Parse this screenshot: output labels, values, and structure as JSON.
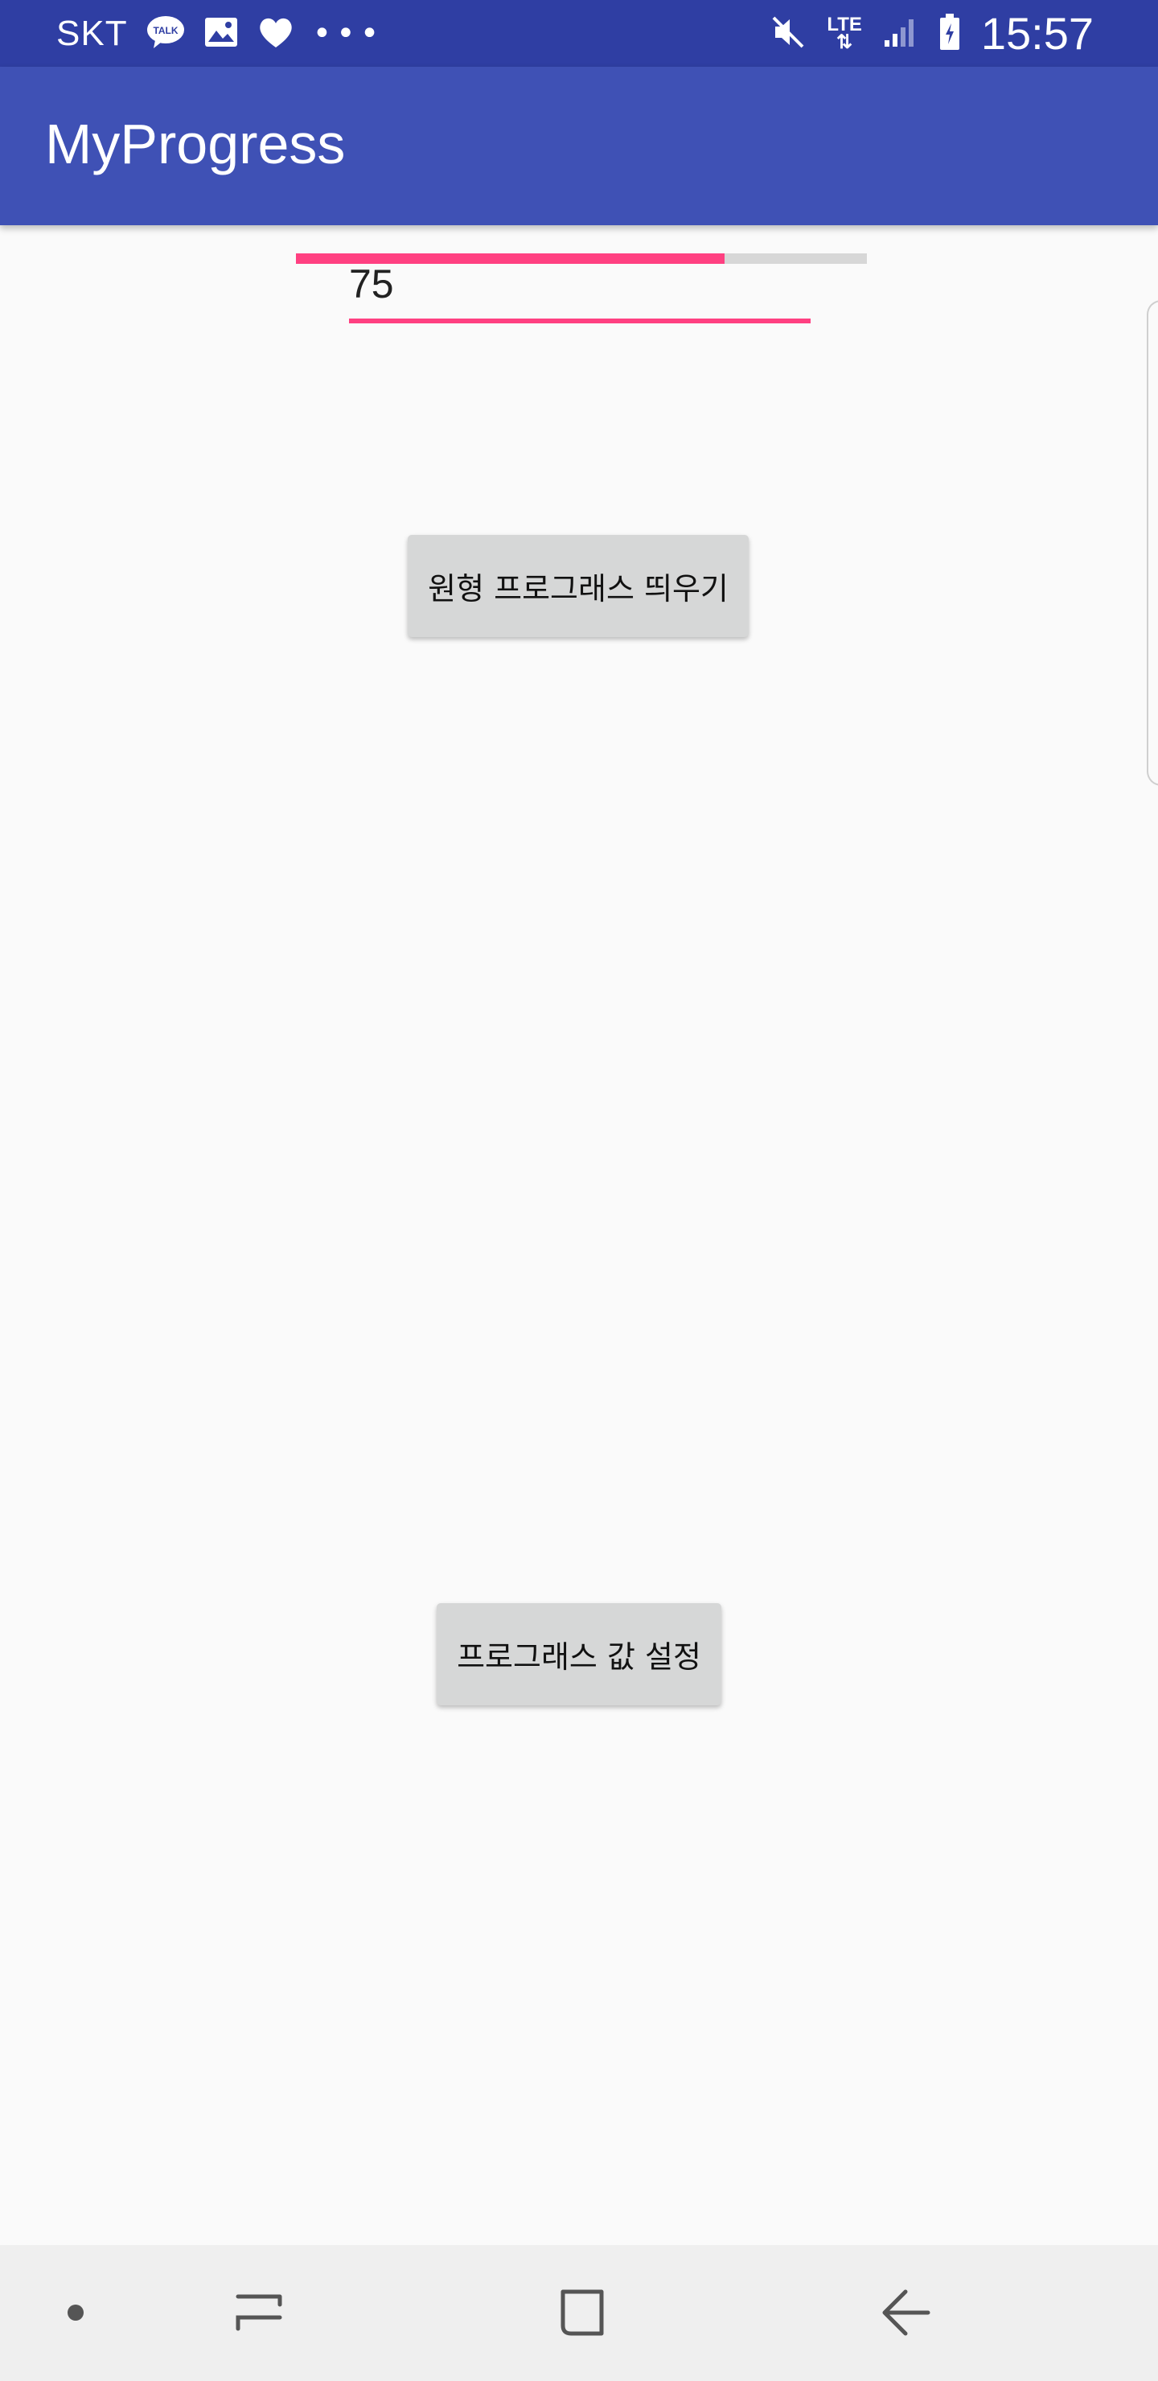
{
  "status_bar": {
    "carrier": "SKT",
    "talk_label": "TALK",
    "network": "LTE",
    "time": "15:57",
    "overflow_dots": "•••"
  },
  "app_bar": {
    "title": "MyProgress"
  },
  "progress": {
    "value": 75,
    "max": 100,
    "fill_color": "#ff4081",
    "track_color": "#d7d7d7"
  },
  "value_field": {
    "value": "75"
  },
  "buttons": {
    "show_circle_progress": "원형 프로그래스 띄우기",
    "set_progress_value": "프로그래스 값 설정"
  },
  "colors": {
    "status_bar": "#2f3ea3",
    "app_bar": "#3f51b5",
    "accent": "#ff4081",
    "button": "#d6d7d7"
  },
  "nav_bar": {
    "icons": [
      "dot-icon",
      "recent-apps-icon",
      "home-icon",
      "back-icon"
    ]
  }
}
